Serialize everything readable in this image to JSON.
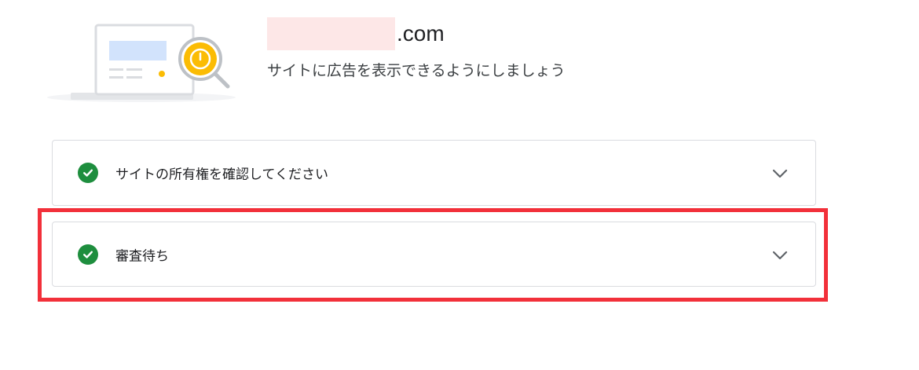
{
  "header": {
    "domain_suffix": ".com",
    "subtitle": "サイトに広告を表示できるようにしましょう"
  },
  "steps": [
    {
      "label": "サイトの所有権を確認してください",
      "status": "complete",
      "icon": "check-circle-icon"
    },
    {
      "label": "審査待ち",
      "status": "complete",
      "icon": "check-circle-icon"
    }
  ],
  "colors": {
    "check": "#1e8e3e",
    "highlight": "#f2303a",
    "redaction": "#fde7e7",
    "illustration_accent": "#fbbc04"
  }
}
